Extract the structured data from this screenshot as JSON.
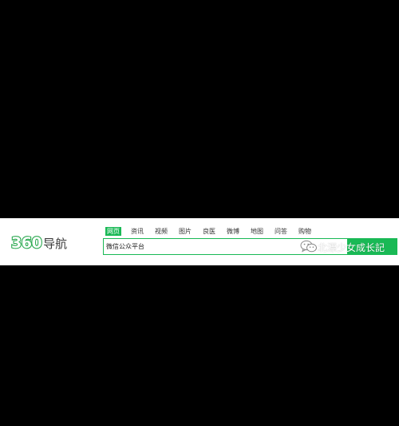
{
  "colors": {
    "brand_green": "#19b955",
    "logo_green": "#2aa84f",
    "background": "#000000",
    "panel": "#ffffff"
  },
  "logo": {
    "number": "360",
    "text": "导航"
  },
  "tabs": [
    {
      "label": "网页",
      "active": true
    },
    {
      "label": "资讯",
      "active": false
    },
    {
      "label": "视频",
      "active": false
    },
    {
      "label": "图片",
      "active": false
    },
    {
      "label": "良医",
      "active": false
    },
    {
      "label": "微博",
      "active": false
    },
    {
      "label": "地图",
      "active": false
    },
    {
      "label": "问答",
      "active": false
    },
    {
      "label": "购物",
      "active": false
    }
  ],
  "search": {
    "value": "微信公众平台",
    "button_icon": "wechat-icon"
  },
  "watermark": {
    "text": "北漂少女成长記"
  }
}
